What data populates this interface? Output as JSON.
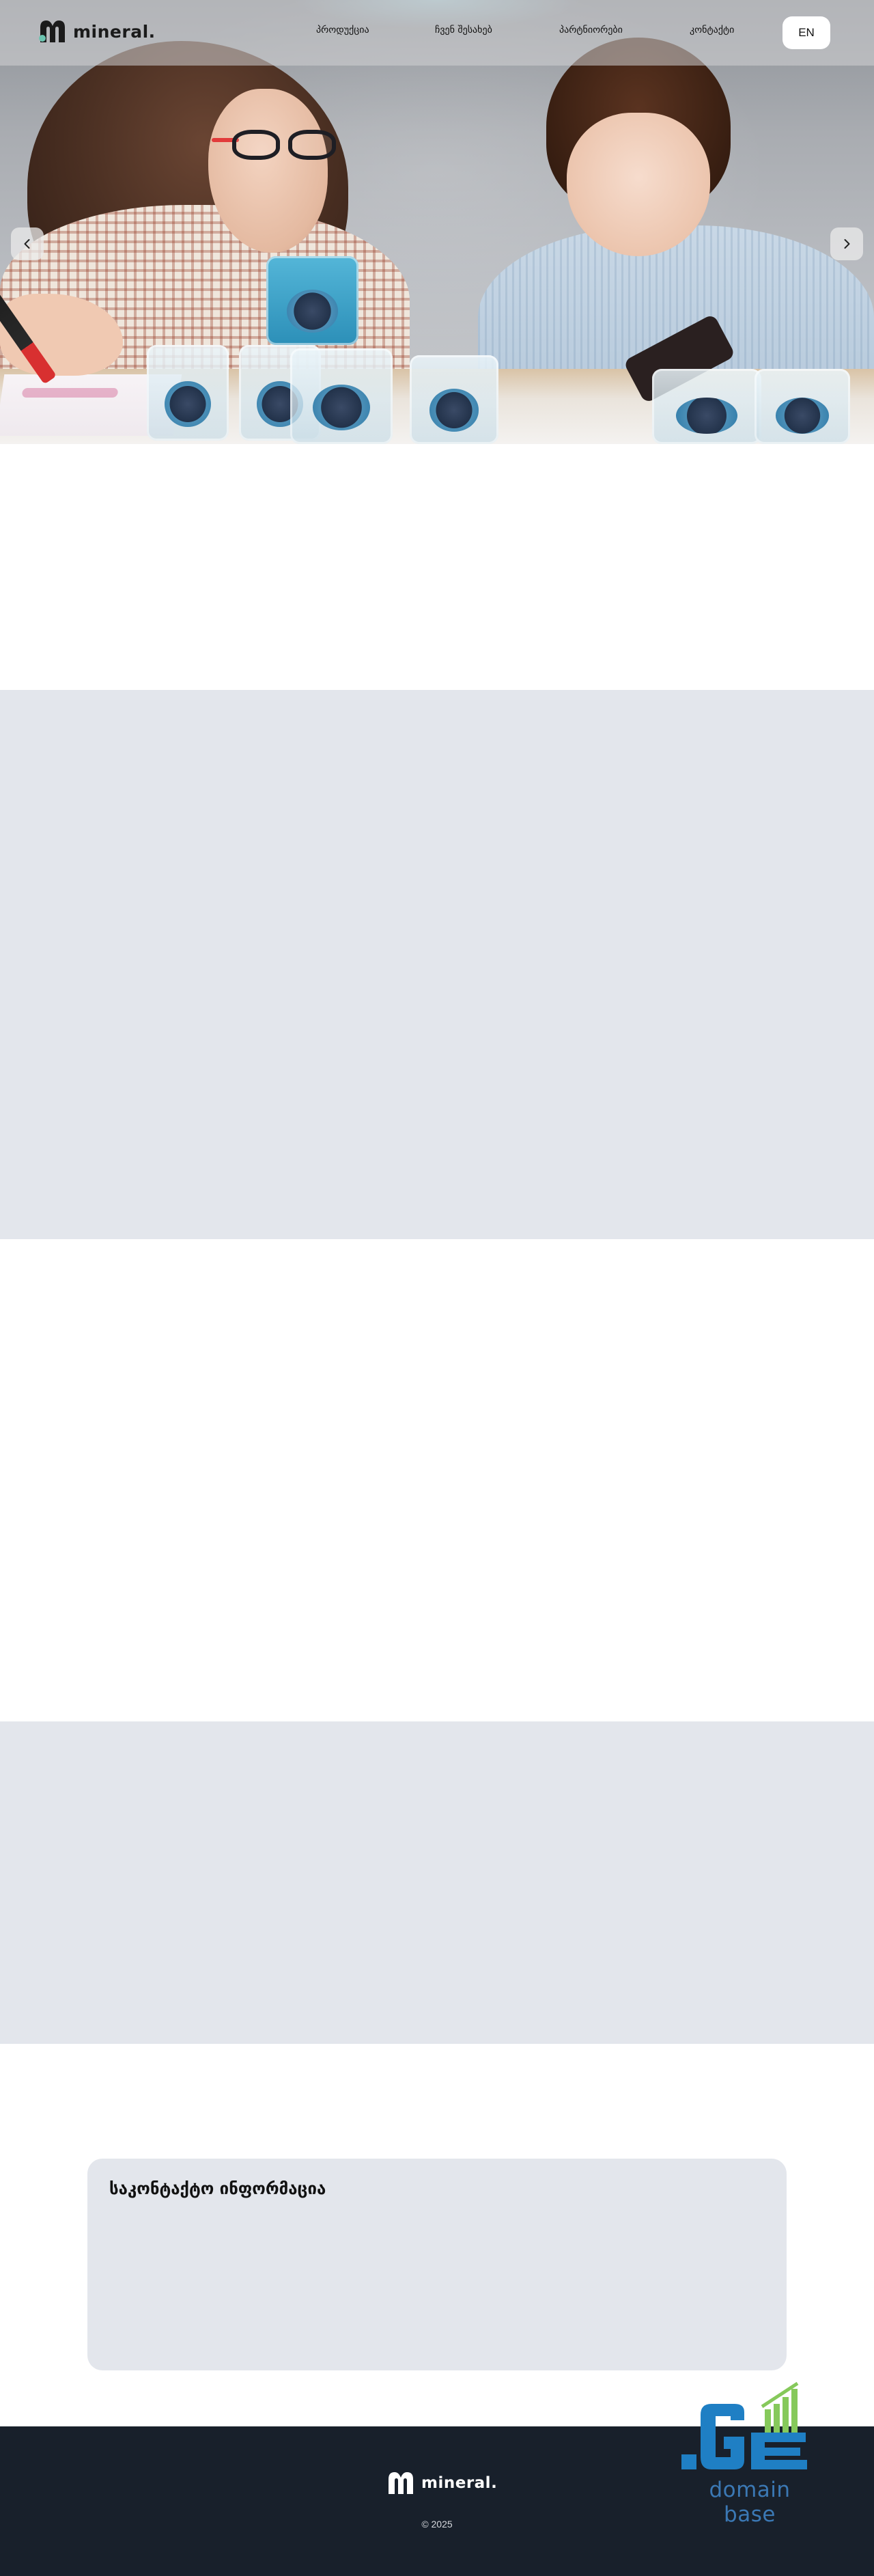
{
  "brand": {
    "name": "mineral.",
    "logo_colors": {
      "mark_dark": "#1b1b1b",
      "mark_accent": "#6cc4b0"
    }
  },
  "nav": {
    "items": [
      {
        "label": "პროდუქცია"
      },
      {
        "label": "ჩვენ შესახებ"
      },
      {
        "label": "პარტნიორები"
      },
      {
        "label": "კონტაქტი"
      }
    ],
    "lang_button": "EN"
  },
  "hero": {
    "prev_icon": "chevron-left-icon",
    "next_icon": "chevron-right-icon"
  },
  "contact": {
    "title": "საკონტაქტო ინფორმაცია"
  },
  "footer": {
    "logo_text": "mineral.",
    "copyright": "© 2025"
  },
  "domain_badge": {
    "text": "domain base",
    "mark": ".GE"
  },
  "colors": {
    "section_gray": "#e3e6ec",
    "footer_bg": "#18202b",
    "badge_blue": "#1f7fc4",
    "badge_green": "#86c95b"
  }
}
